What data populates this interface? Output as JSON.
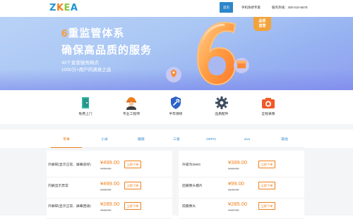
{
  "header": {
    "logo": [
      "Z",
      "K",
      "E",
      "A"
    ],
    "nav_home": "首页",
    "nav_expert": "手机快修专家",
    "hotline": "服务热线：400-010-5678"
  },
  "hero": {
    "title_num": "6",
    "title_rest": "重监管体系",
    "title2": "确保高品质的服务",
    "sub1": "40个直营服务网点",
    "sub2": "1000万+用户的满意之选",
    "badge_line1": "品质",
    "badge_line2": "直营",
    "colors": {
      "accent_orange": "#ff9a2e",
      "brand_blue": "#2c86c9"
    }
  },
  "services": [
    {
      "label": "免费上门",
      "icon": "door-icon"
    },
    {
      "label": "专业工程师",
      "icon": "engineer-icon"
    },
    {
      "label": "半年保修",
      "icon": "wrench-shield-icon"
    },
    {
      "label": "品质配件",
      "icon": "gear-icon"
    },
    {
      "label": "全程录像",
      "icon": "camera-icon"
    }
  ],
  "tabs": [
    {
      "label": "苹果",
      "active": true
    },
    {
      "label": "小米",
      "active": false
    },
    {
      "label": "魅族",
      "active": false
    },
    {
      "label": "三星",
      "active": false
    },
    {
      "label": "OPPO",
      "active": false
    },
    {
      "label": "vivo",
      "active": false
    },
    {
      "label": "其他",
      "active": false
    }
  ],
  "products_left": [
    {
      "name": "外屏碎(显示正常、屏幕良好)",
      "price": "¥499.00",
      "old_price": "¥700.00",
      "button": "立即下单"
    },
    {
      "name": "内屏显示异常",
      "price": "¥499.00",
      "old_price": "¥900.00",
      "button": "立即下单"
    },
    {
      "name": "外屏碎(显示正常、屏幕回收)",
      "price": "¥289.00",
      "old_price": "¥523.00",
      "button": "立即下单"
    }
  ],
  "products_right": [
    {
      "name": "升级为256G",
      "price": "¥399.00",
      "old_price": "¥660.00",
      "button": "立即下单"
    },
    {
      "name": "后摄像头模片",
      "price": "¥99.00",
      "old_price": "¥146.00",
      "button": "立即下单"
    },
    {
      "name": "前摄像头",
      "price": "¥285.00",
      "old_price": "¥427.00",
      "button": "立即下单"
    }
  ]
}
